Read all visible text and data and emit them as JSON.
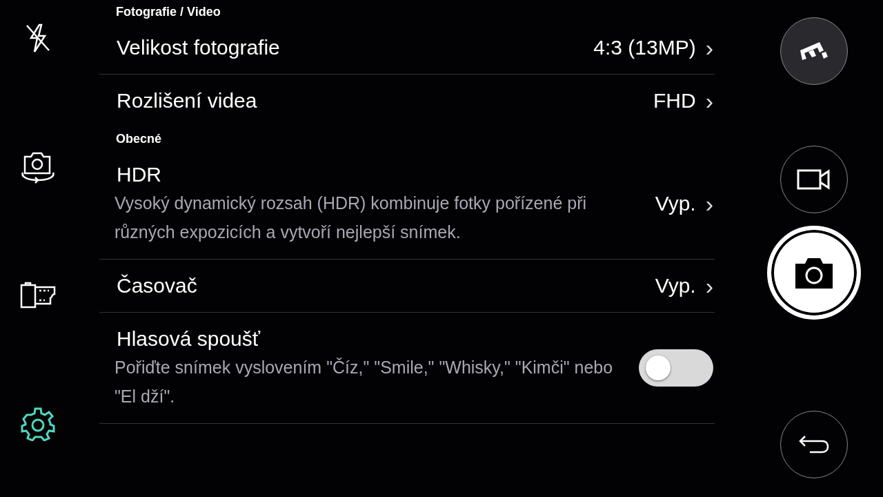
{
  "sections": [
    {
      "header": "Fotografie / Video",
      "items": [
        {
          "kind": "value",
          "title": "Velikost fotografie",
          "value": "4:3 (13MP)",
          "chevron": "›"
        },
        {
          "kind": "value",
          "title": "Rozlišení videa",
          "value": "FHD",
          "chevron": "›"
        }
      ]
    },
    {
      "header": "Obecné",
      "items": [
        {
          "kind": "value",
          "title": "HDR",
          "description": "Vysoký dynamický rozsah (HDR) kombinuje fotky pořízené při různých expozicích a vytvoří nejlepší snímek.",
          "value": "Vyp.",
          "chevron": "›"
        },
        {
          "kind": "value",
          "title": "Časovač",
          "value": "Vyp.",
          "chevron": "›"
        },
        {
          "kind": "toggle",
          "title": "Hlasová spoušť",
          "description": "Pořiďte snímek vyslovením \"Číz,\" \"Smile,\" \"Whisky,\" \"Kimči\" nebo \"El dží\".",
          "on": false
        }
      ]
    }
  ],
  "left_toolbar": [
    {
      "kind": "flash-off",
      "selected": false
    },
    {
      "kind": "switch-camera",
      "selected": false
    },
    {
      "kind": "film",
      "selected": false
    },
    {
      "kind": "settings",
      "selected": true
    }
  ]
}
